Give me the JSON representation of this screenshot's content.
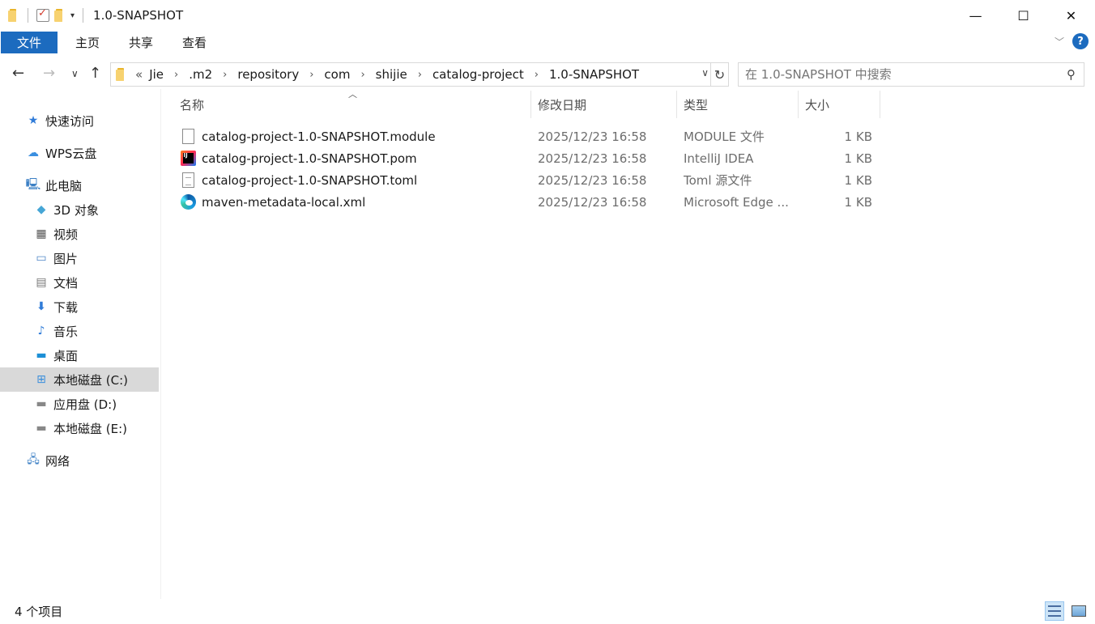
{
  "window": {
    "title": "1.0-SNAPSHOT",
    "controls": {
      "minimize": "—",
      "maximize": "☐",
      "close": "✕"
    }
  },
  "ribbon": {
    "tabs": [
      "文件",
      "主页",
      "共享",
      "查看"
    ]
  },
  "address": {
    "overflow": "«",
    "crumbs": [
      "Jie",
      ".m2",
      "repository",
      "com",
      "shijie",
      "catalog-project",
      "1.0-SNAPSHOT"
    ]
  },
  "search": {
    "placeholder": "在 1.0-SNAPSHOT 中搜索"
  },
  "sidebar": {
    "quick_access": "快速访问",
    "wps_cloud": "WPS云盘",
    "this_pc": "此电脑",
    "objects_3d": "3D 对象",
    "videos": "视频",
    "pictures": "图片",
    "documents": "文档",
    "downloads": "下载",
    "music": "音乐",
    "desktop": "桌面",
    "drive_c": "本地磁盘 (C:)",
    "drive_d": "应用盘 (D:)",
    "drive_e": "本地磁盘 (E:)",
    "network": "网络"
  },
  "columns": {
    "name": "名称",
    "date": "修改日期",
    "type": "类型",
    "size": "大小"
  },
  "files": [
    {
      "name": "catalog-project-1.0-SNAPSHOT.module",
      "date": "2025/12/23 16:58",
      "type": "MODULE 文件",
      "size": "1 KB",
      "icon": "blank-file-icon"
    },
    {
      "name": "catalog-project-1.0-SNAPSHOT.pom",
      "date": "2025/12/23 16:58",
      "type": "IntelliJ IDEA",
      "size": "1 KB",
      "icon": "intellij-icon"
    },
    {
      "name": "catalog-project-1.0-SNAPSHOT.toml",
      "date": "2025/12/23 16:58",
      "type": "Toml 源文件",
      "size": "1 KB",
      "icon": "text-file-icon"
    },
    {
      "name": "maven-metadata-local.xml",
      "date": "2025/12/23 16:58",
      "type": "Microsoft Edge ...",
      "size": "1 KB",
      "icon": "edge-icon"
    }
  ],
  "status": {
    "count": "4 个项目"
  },
  "colors": {
    "accent": "#1c6bbf",
    "selection": "#d9d9d9"
  }
}
